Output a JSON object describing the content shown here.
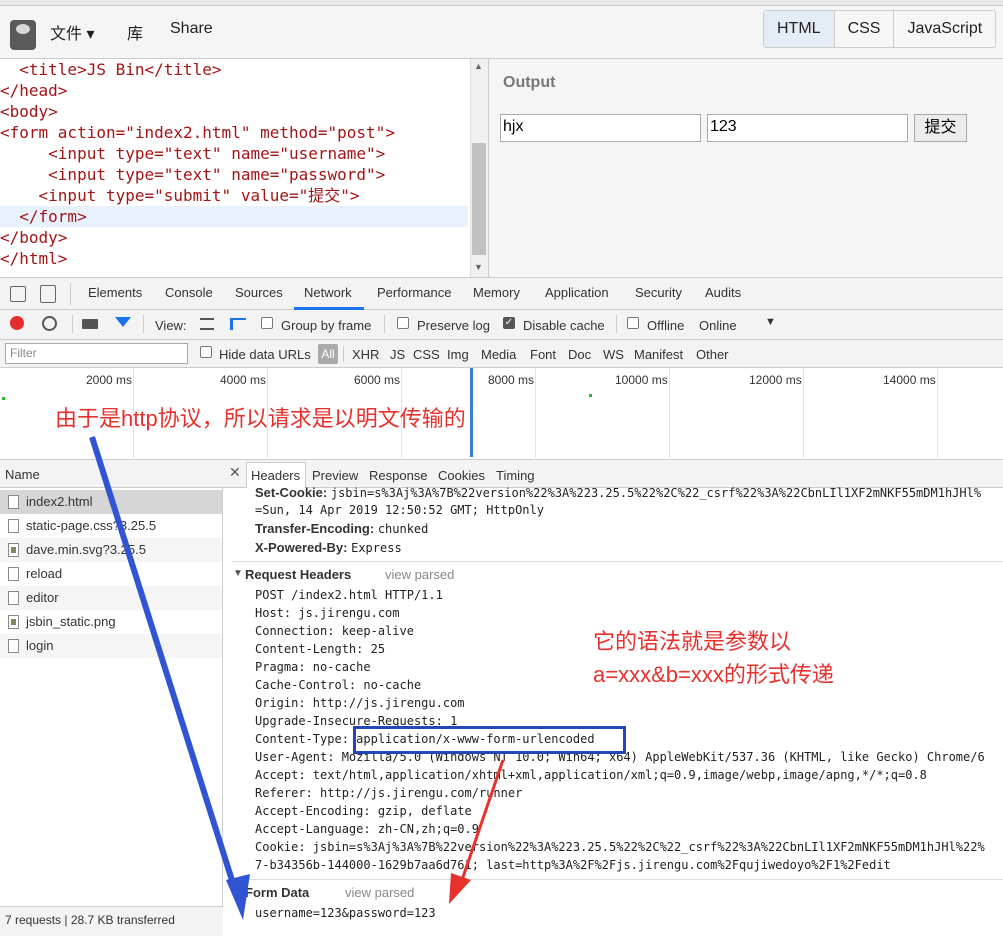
{
  "jsbin": {
    "menu": [
      "文件 ▾",
      "库",
      "Share"
    ],
    "panels": [
      "HTML",
      "CSS",
      "JavaScript"
    ],
    "active_panel": "HTML"
  },
  "editor": {
    "lines": [
      "  <title>JS Bin</title>",
      "</head>",
      "<body>",
      "<form action=\"index2.html\" method=\"post\">",
      "     <input type=\"text\" name=\"username\">",
      "     <input type=\"text\" name=\"password\">",
      "    <input type=\"submit\" value=\"提交\">",
      "  </form>",
      "</body>",
      "</html>"
    ]
  },
  "output": {
    "title": "Output",
    "username_value": "hjx",
    "password_value": "123",
    "submit_label": "提交"
  },
  "devtools": {
    "tabs": [
      "Elements",
      "Console",
      "Sources",
      "Network",
      "Performance",
      "Memory",
      "Application",
      "Security",
      "Audits"
    ],
    "active_tab": "Network",
    "toolbar": {
      "view_label": "View:",
      "group_by_frame": "Group by frame",
      "preserve_log": "Preserve log",
      "disable_cache": "Disable cache",
      "offline": "Offline",
      "online": "Online"
    },
    "filter": {
      "placeholder": "Filter",
      "hide_data_urls": "Hide data URLs",
      "all": "All",
      "types": [
        "XHR",
        "JS",
        "CSS",
        "Img",
        "Media",
        "Font",
        "Doc",
        "WS",
        "Manifest",
        "Other"
      ]
    },
    "timeline_labels": [
      "2000 ms",
      "4000 ms",
      "6000 ms",
      "8000 ms",
      "10000 ms",
      "12000 ms",
      "14000 ms"
    ],
    "requests": {
      "header": "Name",
      "items": [
        "index2.html",
        "static-page.css?3.25.5",
        "dave.min.svg?3.25.5",
        "reload",
        "editor",
        "jsbin_static.png",
        "login"
      ],
      "footer": "7 requests | 28.7 KB transferred"
    },
    "detail_tabs": [
      "Headers",
      "Preview",
      "Response",
      "Cookies",
      "Timing"
    ],
    "response_headers_tail": {
      "set_cookie_key": "Set-Cookie:",
      "set_cookie_val": "jsbin=s%3Aj%3A%7B%22version%22%3A%223.25.5%22%2C%22_csrf%22%3A%22CbnLIl1XF2mNKF55mDM1hJHl%",
      "set_cookie_cont": "=Sun, 14 Apr 2019 12:50:52 GMT; HttpOnly",
      "te_key": "Transfer-Encoding:",
      "te_val": "chunked",
      "xpb_key": "X-Powered-By:",
      "xpb_val": "Express"
    },
    "request_headers": {
      "title": "Request Headers",
      "view_parsed": "view parsed",
      "lines": [
        "POST /index2.html HTTP/1.1",
        "Host: js.jirengu.com",
        "Connection: keep-alive",
        "Content-Length: 25",
        "Pragma: no-cache",
        "Cache-Control: no-cache",
        "Origin: http://js.jirengu.com",
        "Upgrade-Insecure-Requests: 1",
        "Content-Type: application/x-www-form-urlencoded",
        "User-Agent: Mozilla/5.0 (Windows NT 10.0; Win64; x64) AppleWebKit/537.36 (KHTML, like Gecko) Chrome/6",
        "Accept: text/html,application/xhtml+xml,application/xml;q=0.9,image/webp,image/apng,*/*;q=0.8",
        "Referer: http://js.jirengu.com/runner",
        "Accept-Encoding: gzip, deflate",
        "Accept-Language: zh-CN,zh;q=0.9",
        "Cookie: jsbin=s%3Aj%3A%7B%22version%22%3A%223.25.5%22%2C%22_csrf%22%3A%22CbnLIl1XF2mNKF55mDM1hJHl%22%",
        "7-b34356b-144000-1629b7aa6d761; last=http%3A%2F%2Fjs.jirengu.com%2Fqujiwedoyo%2F1%2Fedit"
      ]
    },
    "form_data": {
      "title": "Form Data",
      "view_parsed": "view parsed",
      "value": "username=123&password=123"
    }
  },
  "annotations": {
    "http_note": "由于是http协议，所以请求是以明文传输的",
    "syntax_note_1": "它的语法就是参数以",
    "syntax_note_2": "a=xxx&b=xxx的形式传递",
    "arrow_blue_color": "#2f55d4",
    "arrow_red_color": "#e8312d"
  }
}
